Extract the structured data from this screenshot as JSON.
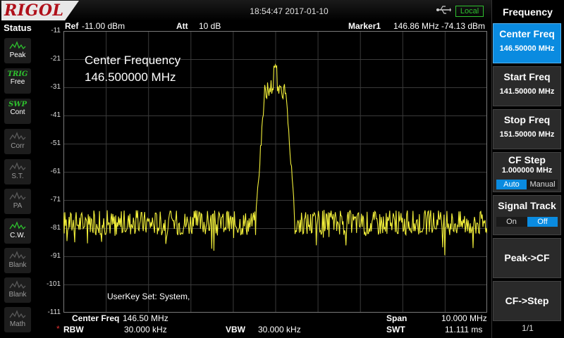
{
  "brand": "RIGOL",
  "datetime": "18:54:47 2017-01-10",
  "local_label": "Local",
  "status": {
    "title": "Status",
    "buttons": [
      {
        "icon": "peak-detect-icon",
        "label": "Peak",
        "top": "",
        "active": true
      },
      {
        "icon": "",
        "label": "Free",
        "top": "TRIG",
        "active": true
      },
      {
        "icon": "",
        "label": "Cont",
        "top": "SWP",
        "active": true
      },
      {
        "icon": "corr-icon",
        "label": "Corr",
        "top": "",
        "active": false
      },
      {
        "icon": "st-icon",
        "label": "S.T.",
        "top": "",
        "active": false
      },
      {
        "icon": "pa-icon",
        "label": "PA",
        "top": "",
        "active": false
      },
      {
        "icon": "cw-icon",
        "label": "C.W.",
        "top": "",
        "active": true
      },
      {
        "icon": "blank-icon",
        "label": "Blank",
        "top": "",
        "active": false
      },
      {
        "icon": "blank-icon",
        "label": "Blank",
        "top": "",
        "active": false
      },
      {
        "icon": "math-icon",
        "label": "Math",
        "top": "",
        "active": false
      }
    ]
  },
  "header": {
    "ref_label": "Ref",
    "ref_value": "-11.00 dBm",
    "att_label": "Att",
    "att_value": "10 dB",
    "marker_label": "Marker1",
    "marker_freq": "146.86 MHz",
    "marker_level": "-74.13 dBm"
  },
  "y_ticks": [
    "-11",
    "-21",
    "-31",
    "-41",
    "-51",
    "-61",
    "-71",
    "-81",
    "-91",
    "-101",
    "-111"
  ],
  "center_note": {
    "line1": "Center Frequency",
    "line2": "146.500000 MHz"
  },
  "userkey": "UserKey Set:   System,",
  "footer": {
    "center_label": "Center Freq",
    "center_value": "146.50 MHz",
    "span_label": "Span",
    "span_value": "10.000 MHz",
    "rbw_label": "RBW",
    "rbw_value": "30.000 kHz",
    "vbw_label": "VBW",
    "vbw_value": "30.000 kHz",
    "swt_label": "SWT",
    "swt_value": "11.111 ms",
    "rbw_marker": "*"
  },
  "menu": {
    "title": "Frequency",
    "center_freq": {
      "label": "Center Freq",
      "value": "146.50000 MHz"
    },
    "start_freq": {
      "label": "Start Freq",
      "value": "141.50000 MHz"
    },
    "stop_freq": {
      "label": "Stop Freq",
      "value": "151.50000 MHz"
    },
    "cf_step": {
      "label": "CF Step",
      "value": "1.000000 MHz",
      "opt_auto": "Auto",
      "opt_manual": "Manual"
    },
    "signal_track": {
      "label": "Signal Track",
      "opt_on": "On",
      "opt_off": "Off"
    },
    "peak_cf": "Peak->CF",
    "cf_step_key": "CF->Step",
    "page": "1/1"
  },
  "chart_data": {
    "type": "line",
    "x_start_mhz": 141.5,
    "x_stop_mhz": 151.5,
    "ylim": [
      -111,
      -11
    ],
    "y_unit": "dBm",
    "grid": true,
    "trace_color": "#f2ef3a",
    "noise_floor_dbm": -79,
    "peak_freq_mhz": 146.5,
    "peak_level_dbm": -24,
    "signal_width_mhz": 0.5
  }
}
